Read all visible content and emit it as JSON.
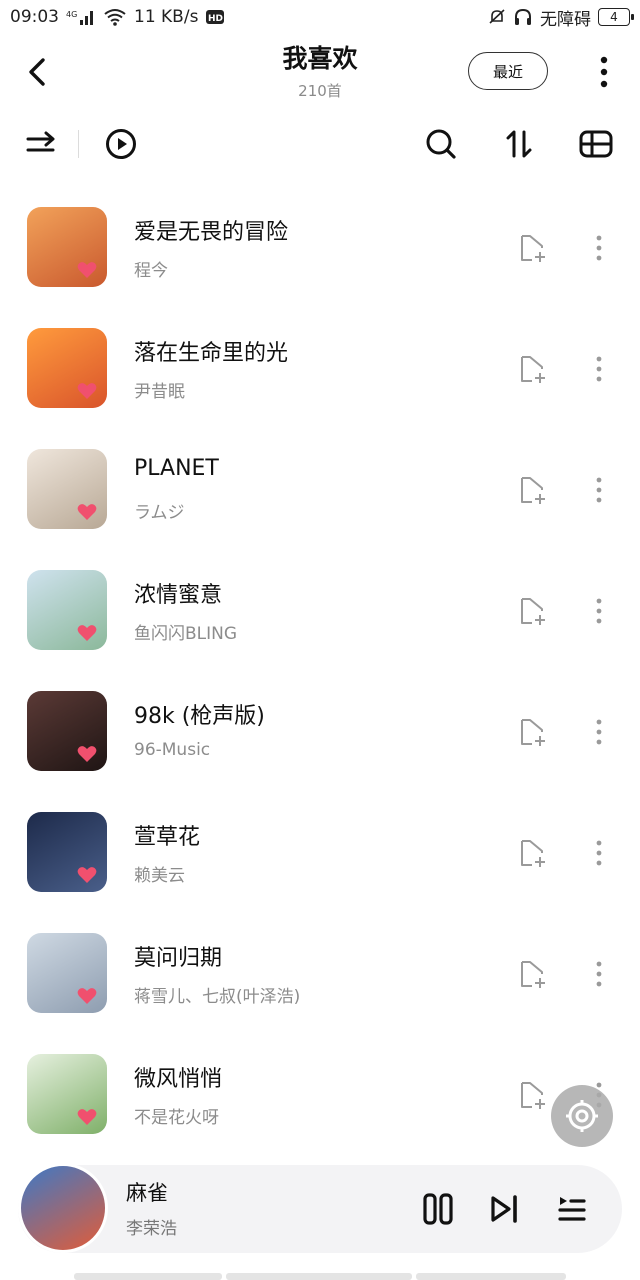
{
  "status_bar": {
    "time": "09:03",
    "network": "4G",
    "speed": "11 KB/s",
    "hd": "HD",
    "accessibility": "无障碍",
    "battery": "4"
  },
  "header": {
    "title": "我喜欢",
    "count": "210首",
    "recent_label": "最近"
  },
  "toolbar": {
    "icons": [
      "shuffle-icon",
      "play-circle-icon",
      "search-icon",
      "sort-icon",
      "manage-icon"
    ]
  },
  "songs": [
    {
      "title": "爱是无畏的冒险",
      "artist": "程今",
      "cover_colors": [
        "#f2a25a",
        "#c9592e"
      ]
    },
    {
      "title": "落在生命里的光",
      "artist": "尹昔眠",
      "cover_colors": [
        "#ff9b3d",
        "#d9542b"
      ]
    },
    {
      "title": "PLANET",
      "artist": "ラムジ",
      "cover_colors": [
        "#efe6dc",
        "#b8a895"
      ]
    },
    {
      "title": "浓情蜜意",
      "artist": "鱼闪闪BLING",
      "cover_colors": [
        "#cfe2ee",
        "#8bb89a"
      ]
    },
    {
      "title": "98k (枪声版)",
      "artist": "96-Music",
      "cover_colors": [
        "#5b3a36",
        "#1f1514"
      ]
    },
    {
      "title": "萱草花",
      "artist": "赖美云",
      "cover_colors": [
        "#1d2a4a",
        "#4a5f8a"
      ]
    },
    {
      "title": "莫问归期",
      "artist": "蒋雪儿、七叔(叶泽浩)",
      "cover_colors": [
        "#cfd9e3",
        "#8e9db0"
      ]
    },
    {
      "title": "微风悄悄",
      "artist": "不是花火呀",
      "cover_colors": [
        "#e6f0df",
        "#7fb069"
      ]
    }
  ],
  "now_playing": {
    "title": "麻雀",
    "artist": "李荣浩",
    "cover_colors": [
      "#3d79c6",
      "#e25c38"
    ]
  },
  "colors": {
    "heart": "#f0506e",
    "icon": "#1a1a1a",
    "muted_icon": "#9a9a9a"
  }
}
